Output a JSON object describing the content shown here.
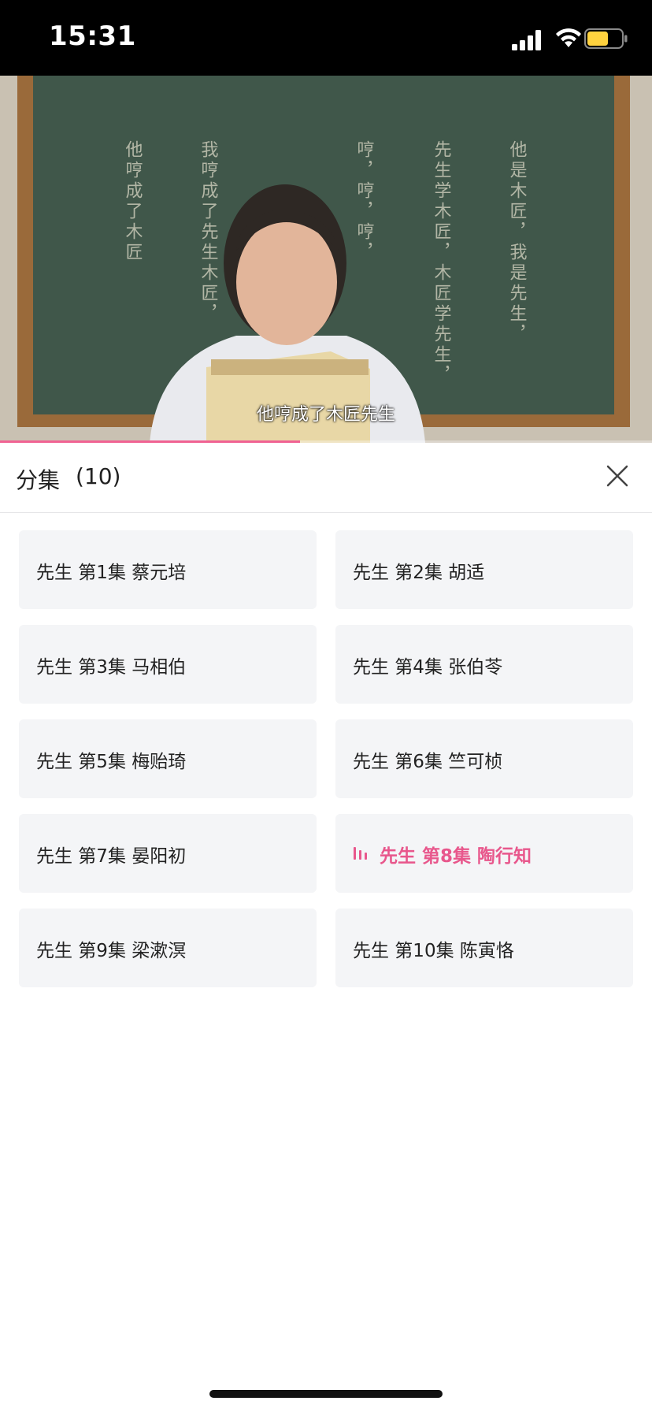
{
  "status_bar": {
    "time": "15:31",
    "icons": [
      "signal-icon",
      "wifi-icon",
      "battery-icon"
    ],
    "battery_color": "#ffd23f"
  },
  "video": {
    "subtitle": "他哼成了木匠先生",
    "progress_fraction": 0.46,
    "accent_color": "#f06292",
    "board_columns": [
      "他是木匠，我是先生，",
      "先生学木匠，木匠学先生，",
      "哼，哼，哼，",
      "我哼成了先生木匠，",
      "他哼成了木匠"
    ]
  },
  "sheet": {
    "title": "分集",
    "count": "(10)",
    "close_icon": "close-icon"
  },
  "episodes": [
    {
      "label": "先生 第1集 蔡元培",
      "active": false
    },
    {
      "label": "先生 第2集 胡适",
      "active": false
    },
    {
      "label": "先生 第3集 马相伯",
      "active": false
    },
    {
      "label": "先生 第4集 张伯苓",
      "active": false
    },
    {
      "label": "先生 第5集  梅贻琦",
      "active": false
    },
    {
      "label": "先生 第6集 竺可桢",
      "active": false
    },
    {
      "label": "先生 第7集 晏阳初",
      "active": false
    },
    {
      "label": "先生 第8集 陶行知",
      "active": true
    },
    {
      "label": "先生 第9集 梁漱溟",
      "active": false
    },
    {
      "label": "先生 第10集 陈寅恪",
      "active": false
    }
  ],
  "colors": {
    "active_text": "#e8578c",
    "card_bg": "#f4f5f7"
  }
}
